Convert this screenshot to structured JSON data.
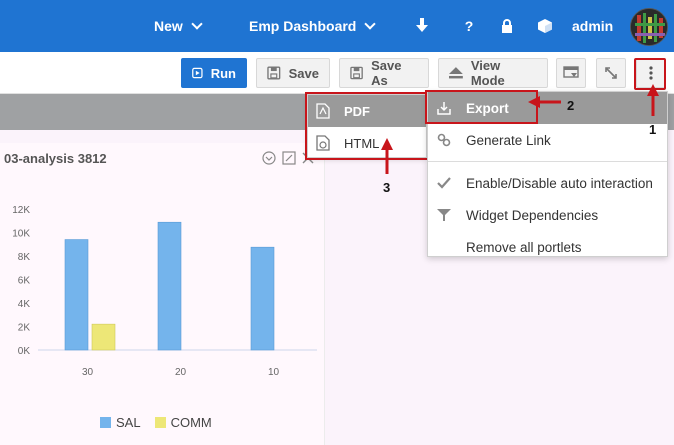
{
  "topbar": {
    "new_label": "New",
    "dashboard_label": "Emp Dashboard",
    "user_label": "admin",
    "icons": [
      "download-icon",
      "help-icon",
      "lock-icon",
      "cube-icon"
    ]
  },
  "toolbar": {
    "run_label": "Run",
    "save_label": "Save",
    "save_as_label": "Save As",
    "view_mode_label": "View Mode"
  },
  "portlet": {
    "title": "03-analysis 3812"
  },
  "export_submenu": {
    "items": [
      {
        "label": "PDF",
        "icon": "pdf-file-icon"
      },
      {
        "label": "HTML",
        "icon": "html-file-icon"
      }
    ]
  },
  "dropdown": {
    "items": [
      {
        "label": "Export",
        "icon": "export-icon"
      },
      {
        "label": "Generate Link",
        "icon": "link-icon"
      },
      {
        "label": "Enable/Disable auto interaction",
        "icon": "check-icon"
      },
      {
        "label": "Widget Dependencies",
        "icon": "filter-icon"
      },
      {
        "label": "Remove all portlets",
        "icon": ""
      }
    ]
  },
  "annotations": {
    "step1": "1",
    "step2": "2",
    "step3": "3"
  },
  "colors": {
    "brand_blue": "#1f74d2",
    "annotation_red": "#c8151b",
    "sal_bar": "#74b4ec",
    "comm_bar": "#ede777"
  },
  "chart_data": {
    "type": "bar",
    "categories": [
      "30",
      "20",
      "10"
    ],
    "series": [
      {
        "name": "SAL",
        "values": [
          9400,
          10875,
          8750
        ]
      },
      {
        "name": "COMM",
        "values": [
          2200,
          0,
          0
        ]
      }
    ],
    "yticks": [
      "0K",
      "2K",
      "4K",
      "6K",
      "8K",
      "10K",
      "12K"
    ],
    "ylim": [
      0,
      12000
    ],
    "legend": "bottom",
    "grid": false
  }
}
